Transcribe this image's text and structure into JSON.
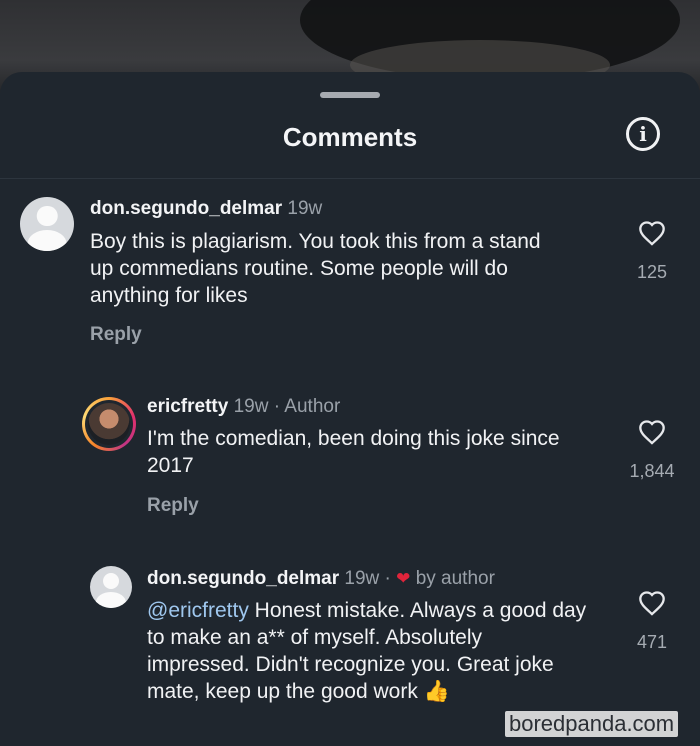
{
  "sheet": {
    "title": "Comments"
  },
  "comments": [
    {
      "username": "don.segundo_delmar",
      "time": "19w",
      "text": "Boy this is plagiarism. You took this from a stand up commedians routine. Some people will do anything for likes",
      "reply_label": "Reply",
      "likes": "125"
    },
    {
      "username": "ericfretty",
      "time": "19w",
      "badge": "· Author",
      "text": "I'm the comedian, been doing this joke since 2017",
      "reply_label": "Reply",
      "likes": "1,844"
    },
    {
      "username": "don.segundo_delmar",
      "time": "19w ·",
      "liked_by": "by author",
      "mention": "@ericfretty",
      "text": " Honest mistake. Always a good day to make an a** of myself. Absolutely impressed. Didn't recognize you. Great joke mate, keep up the good work",
      "emoji": "👍",
      "likes": "471"
    }
  ],
  "watermark": "boredpanda.com",
  "colors": {
    "sheet": "#1f262e",
    "mention": "#9fc7ee",
    "heart": "#e0243b",
    "muted": "#9aa1a9"
  },
  "icons": [
    "info-icon",
    "heart-outline-icon",
    "heart-filled-icon",
    "thumbs-up-emoji"
  ]
}
